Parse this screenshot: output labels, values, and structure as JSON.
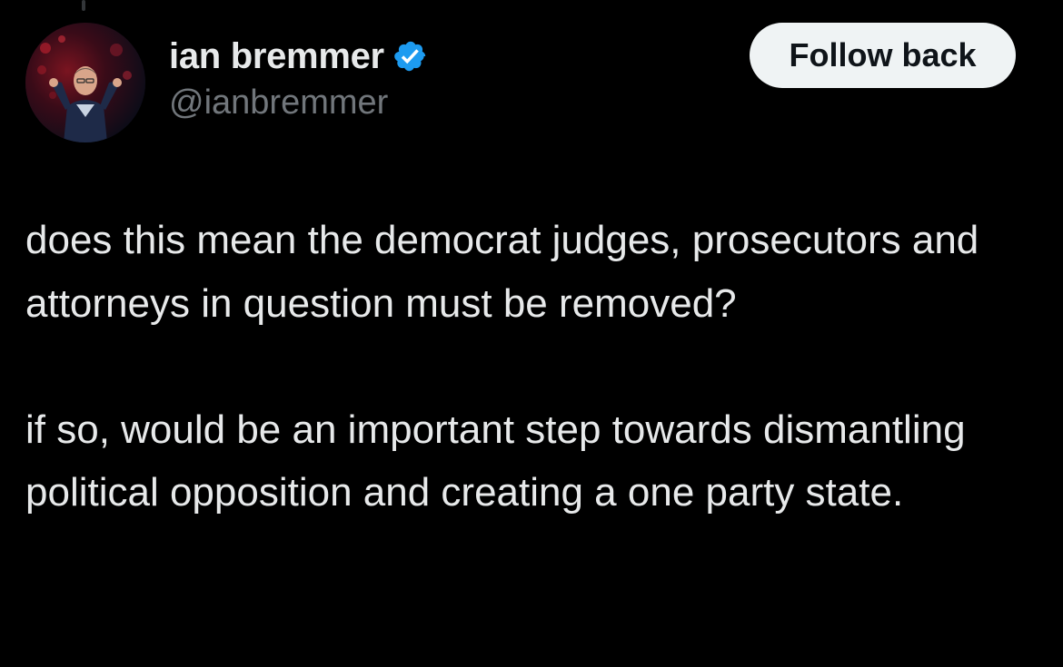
{
  "author": {
    "display_name": "ian bremmer",
    "handle": "@ianbremmer",
    "verified": true,
    "verified_icon": "verified-badge-icon",
    "verified_color": "#1d9bf0"
  },
  "actions": {
    "follow_label": "Follow back"
  },
  "tweet": {
    "paragraphs": [
      "does this mean the democrat judges, prosecutors and attorneys in question must be removed?",
      "if so, would be an important step towards dismantling political opposition and creating a one party state."
    ]
  },
  "theme": {
    "background": "#000000",
    "text": "#e7e9ea",
    "secondary_text": "#71767b",
    "button_bg": "#eff3f4",
    "button_text": "#0f1419"
  }
}
